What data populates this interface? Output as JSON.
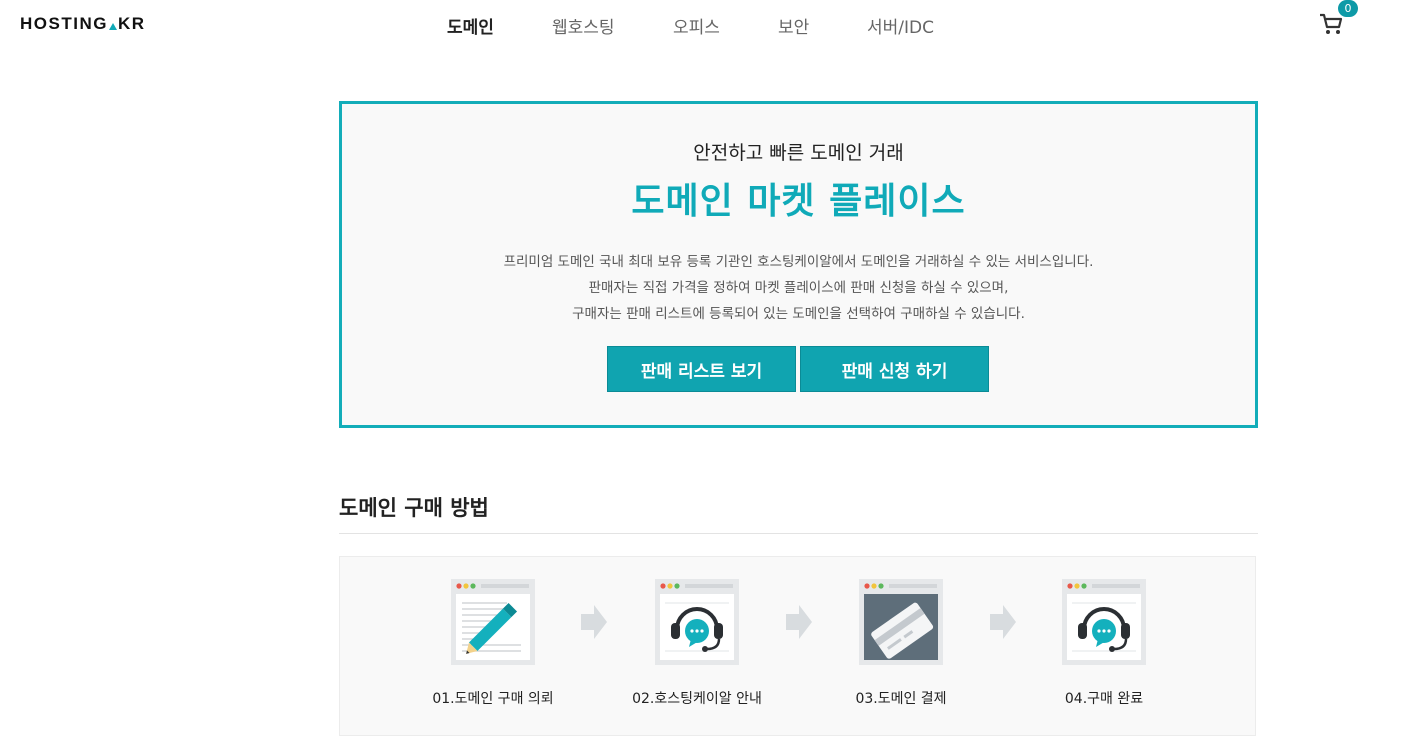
{
  "header": {
    "logo": {
      "left": "HOSTING",
      "right": "KR"
    },
    "nav": [
      {
        "label": "도메인",
        "active": true
      },
      {
        "label": "웹호스팅",
        "active": false
      },
      {
        "label": "오피스",
        "active": false
      },
      {
        "label": "보안",
        "active": false
      },
      {
        "label": "서버/IDC",
        "active": false
      }
    ],
    "cart_count": "0"
  },
  "hero": {
    "subtitle": "안전하고 빠른 도메인 거래",
    "title": "도메인 마켓 플레이스",
    "description": [
      "프리미엄 도메인 국내 최대 보유 등록 기관인 호스팅케이알에서 도메인을 거래하실 수 있는 서비스입니다.",
      "판매자는 직접 가격을 정하여 마켓 플레이스에 판매 신청을 하실 수 있으며,",
      "구매자는 판매 리스트에 등록되어 있는 도메인을 선택하여 구매하실 수 있습니다."
    ],
    "buttons": {
      "list": "판매 리스트 보기",
      "apply": "판매 신청 하기"
    }
  },
  "section": {
    "title": "도메인 구매 방법",
    "steps": [
      {
        "label": "01.도메인 구매 의뢰",
        "icon": "pencil-document-icon"
      },
      {
        "label": "02.호스팅케이알 안내",
        "icon": "headset-support-icon"
      },
      {
        "label": "03.도메인 결제",
        "icon": "credit-card-icon"
      },
      {
        "label": "04.구매 완료",
        "icon": "headset-support-icon"
      }
    ]
  },
  "colors": {
    "accent": "#10aab8",
    "button": "#10a4b0",
    "cart_badge": "#0e9aa7"
  }
}
